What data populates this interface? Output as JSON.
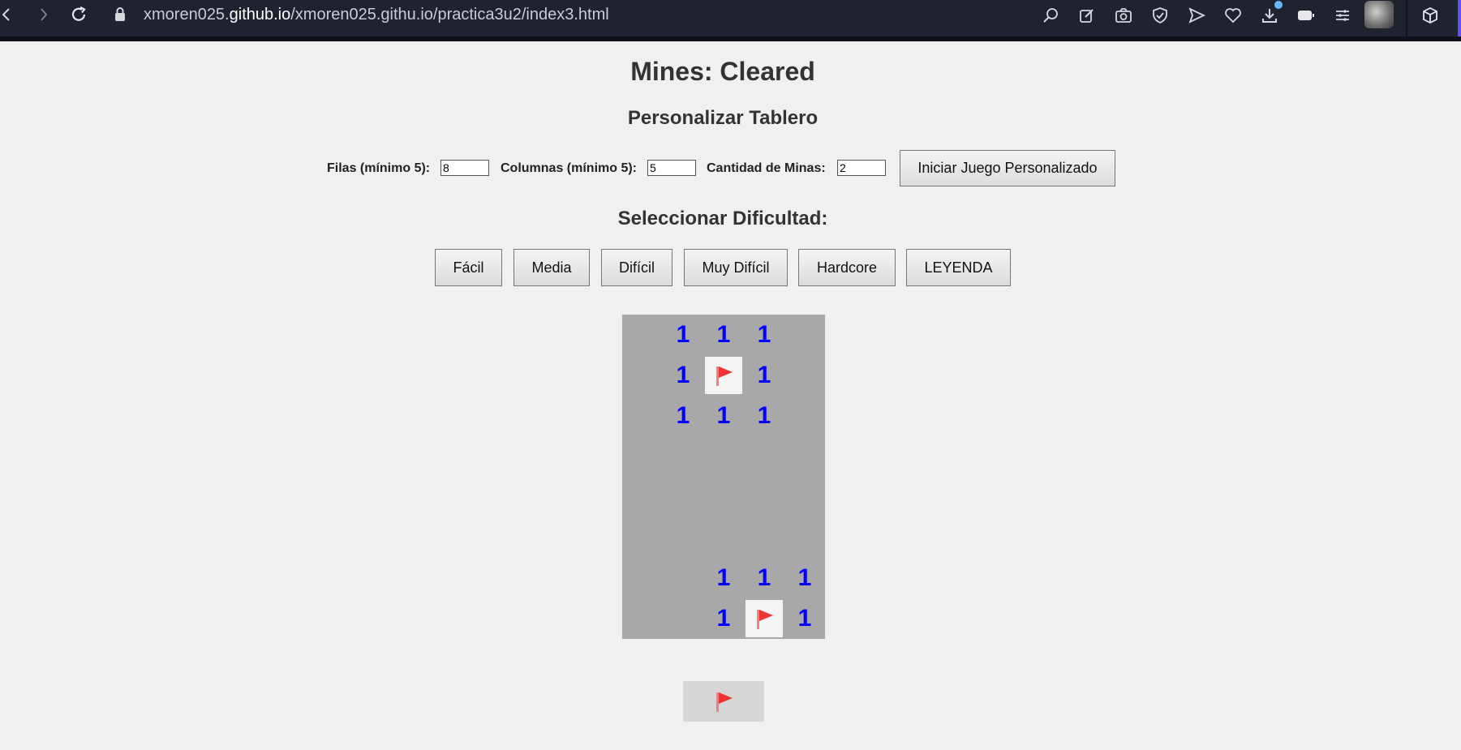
{
  "browser": {
    "url_prefix": "xmoren025.",
    "url_domain": "github.io",
    "url_path": "/xmoren025.githu.io/practica3u2/index3.html"
  },
  "page": {
    "title": "Mines: Cleared",
    "custom_heading": "Personalizar Tablero",
    "difficulty_heading": "Seleccionar Dificultad:"
  },
  "form": {
    "rows_label": "Filas (mínimo 5):",
    "rows_value": "8",
    "cols_label": "Columnas (mínimo 5):",
    "cols_value": "5",
    "mines_label": "Cantidad de Minas:",
    "mines_value": "2",
    "start_button": "Iniciar Juego Personalizado"
  },
  "difficulty": {
    "easy": "Fácil",
    "medium": "Media",
    "hard": "Difícil",
    "very_hard": "Muy Difícil",
    "hardcore": "Hardcore",
    "legend": "LEYENDA"
  },
  "board": {
    "rows": 8,
    "cols": 5,
    "cells": [
      [
        "",
        "1",
        "1",
        "1",
        ""
      ],
      [
        "",
        "1",
        "flag",
        "1",
        ""
      ],
      [
        "",
        "1",
        "1",
        "1",
        ""
      ],
      [
        "",
        "",
        "",
        "",
        ""
      ],
      [
        "",
        "",
        "",
        "",
        ""
      ],
      [
        "",
        "",
        "",
        "",
        ""
      ],
      [
        "",
        "",
        "1",
        "1",
        "1"
      ],
      [
        "",
        "",
        "1",
        "flag",
        "1"
      ]
    ],
    "number_color": "#0000ff",
    "board_color": "#a8a8a8",
    "flag_color": "#ee3333"
  },
  "colors": {
    "page_bg": "#f0f0f0",
    "chrome_bg": "#1f2330"
  }
}
